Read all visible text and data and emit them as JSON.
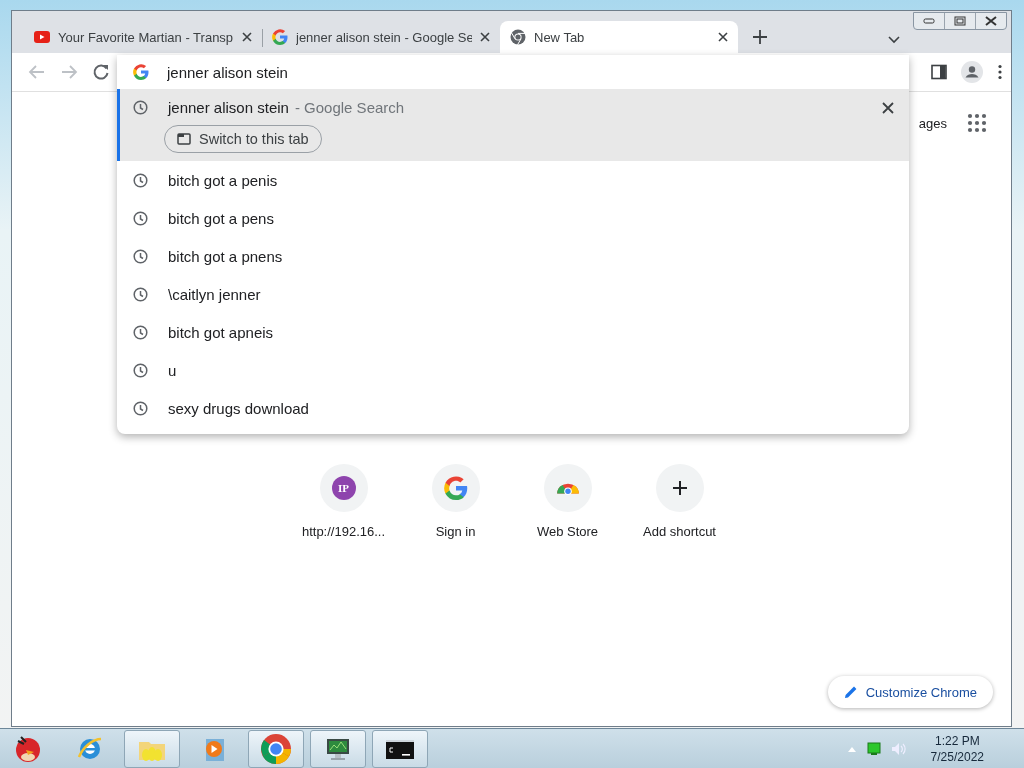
{
  "tabs": [
    {
      "title": "Your Favorite Martian - Transp",
      "kind": "video",
      "selected": false
    },
    {
      "title": "jenner alison stein - Google Se",
      "kind": "search",
      "selected": false
    },
    {
      "title": "New Tab",
      "kind": "newtab",
      "selected": true
    }
  ],
  "omnibox": {
    "value": "jenner alison stein"
  },
  "suggestions": [
    {
      "text": "jenner alison stein",
      "description": "- Google Search",
      "action": "Switch to this tab",
      "selected": true
    },
    {
      "text": "bitch got a penis",
      "selected": false
    },
    {
      "text": "bitch got a pens",
      "selected": false
    },
    {
      "text": "bitch got a pnens",
      "selected": false
    },
    {
      "text": "\\caitlyn jenner",
      "selected": false
    },
    {
      "text": "bitch got apneis",
      "selected": false
    },
    {
      "text": "u",
      "selected": false
    },
    {
      "text": "sexy drugs download",
      "selected": false
    }
  ],
  "new_tab_page": {
    "header_link": "ages",
    "shortcuts": [
      {
        "kind": "site",
        "badge": "IP",
        "label": "http://192.16..."
      },
      {
        "kind": "google",
        "label": "Sign in"
      },
      {
        "kind": "store",
        "label": "Web Store"
      },
      {
        "kind": "add",
        "label": "Add shortcut"
      }
    ],
    "customize_button": "Customize Chrome"
  },
  "taskbar": {
    "apps": [
      {
        "kind": "start",
        "running": false
      },
      {
        "kind": "browser-e",
        "running": false
      },
      {
        "kind": "folder",
        "running": true
      },
      {
        "kind": "media",
        "running": false
      },
      {
        "kind": "chrome",
        "running": true
      },
      {
        "kind": "monitor",
        "running": true
      },
      {
        "kind": "terminal",
        "running": true
      }
    ],
    "time": "1:22 PM",
    "date": "7/25/2022"
  }
}
